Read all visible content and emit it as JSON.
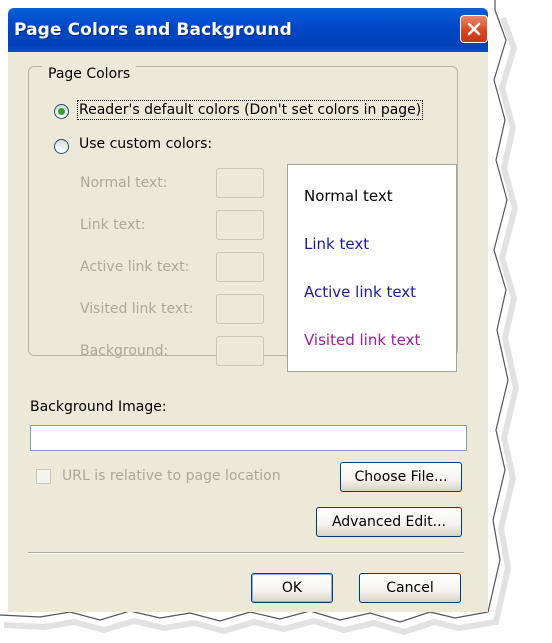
{
  "window": {
    "title": "Page Colors and Background"
  },
  "page_colors": {
    "group_label": "Page Colors",
    "default_option": "Reader's default colors (Don't set colors in page)",
    "custom_option": "Use custom colors:",
    "selected": "default",
    "fields": [
      {
        "label": "Normal text:"
      },
      {
        "label": "Link text:"
      },
      {
        "label": "Active link text:"
      },
      {
        "label": "Visited link text:"
      },
      {
        "label": "Background:"
      }
    ]
  },
  "preview": {
    "normal": "Normal text",
    "link": "Link text",
    "active": "Active link text",
    "visited": "Visited link text",
    "colors": {
      "normal": "#000000",
      "link": "#1a1aa6",
      "active": "#1a1aa6",
      "visited": "#a21ba2"
    }
  },
  "background_image": {
    "label": "Background Image:",
    "value": "",
    "relative_checkbox": "URL is relative to page location",
    "choose_file": "Choose File...",
    "advanced_edit": "Advanced Edit..."
  },
  "buttons": {
    "ok": "OK",
    "cancel": "Cancel"
  },
  "icons": {
    "close": "close-icon",
    "radio_selected": "radio-selected-icon"
  }
}
